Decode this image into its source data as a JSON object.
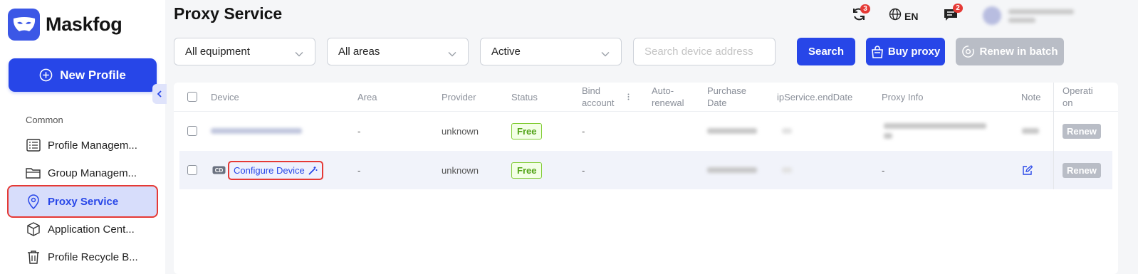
{
  "app": {
    "name": "Maskfog"
  },
  "sidebar": {
    "new_profile_label": "New Profile",
    "section_common": "Common",
    "items": [
      {
        "label": "Profile Managem...",
        "icon": "profile-list-icon",
        "active": false
      },
      {
        "label": "Group Managem...",
        "icon": "folder-icon",
        "active": false
      },
      {
        "label": "Proxy Service",
        "icon": "location-pin-icon",
        "active": true
      },
      {
        "label": "Application Cent...",
        "icon": "cube-icon",
        "active": false
      },
      {
        "label": "Profile Recycle B...",
        "icon": "trash-icon",
        "active": false
      }
    ]
  },
  "header": {
    "title": "Proxy Service",
    "sync_badge": "3",
    "language": "EN",
    "messages_badge": "2"
  },
  "filters": {
    "equipment": "All equipment",
    "areas": "All areas",
    "status": "Active",
    "search_placeholder": "Search device address",
    "search_label": "Search",
    "buy_proxy_label": "Buy proxy",
    "renew_batch_label": "Renew in batch"
  },
  "table": {
    "columns": {
      "device": "Device",
      "area": "Area",
      "provider": "Provider",
      "status": "Status",
      "bind_account": "Bind account",
      "auto_renewal": "Auto-renewal",
      "purchase_date": "Purchase Date",
      "end_date": "ipService.endDate",
      "proxy_info": "Proxy Info",
      "note": "Note",
      "operation": "Operation"
    },
    "rows": [
      {
        "device": "",
        "area": "-",
        "provider": "unknown",
        "status": "Free",
        "bind_account": "-",
        "proxy_info": "",
        "operation": "Renew"
      },
      {
        "device": "Configure Device",
        "area": "-",
        "provider": "unknown",
        "status": "Free",
        "bind_account": "-",
        "proxy_info": "-",
        "operation": "Renew"
      }
    ]
  },
  "colors": {
    "primary": "#2746e8",
    "active_nav_bg": "#d7ddfb",
    "highlight_border": "#e53935",
    "free_tag": "#52a317",
    "disabled": "#b9bdc6"
  }
}
